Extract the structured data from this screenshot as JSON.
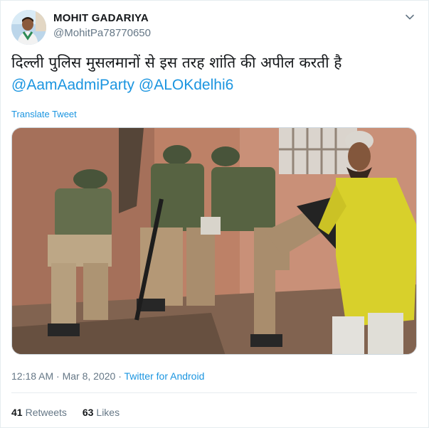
{
  "user": {
    "display_name": "MOHIT GADARIYA",
    "handle": "@MohitPa78770650"
  },
  "tweet": {
    "text": "दिल्ली पुलिस मुसलमानों से इस तरह शांति की अपील करती है",
    "mentions": [
      "@AamAadmiParty",
      "@ALOKdelhi6"
    ],
    "translate_label": "Translate Tweet"
  },
  "meta": {
    "time": "12:18 AM",
    "separator": "·",
    "date": "Mar 8, 2020",
    "source": "Twitter for Android"
  },
  "stats": {
    "retweets_count": "41",
    "retweets_label": "Retweets",
    "likes_count": "63",
    "likes_label": "Likes"
  },
  "icons": {
    "caret": "chevron-down-icon",
    "avatar": "avatar"
  },
  "colors": {
    "link": "#1b95e0",
    "text": "#14171a",
    "secondary": "#657786",
    "border": "#e6ecf0"
  }
}
